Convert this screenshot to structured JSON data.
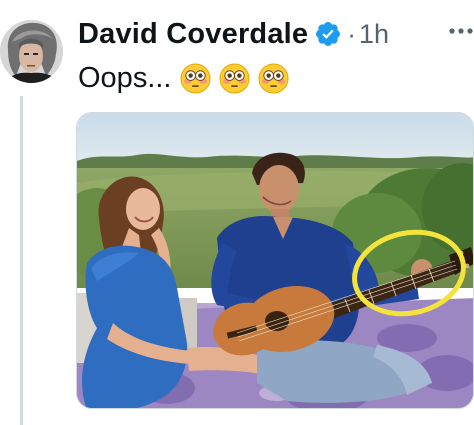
{
  "post": {
    "author_name": "David Coverdale",
    "separator": "·",
    "timestamp": "1h",
    "text": "Oops...",
    "emojis": [
      "flushed-face",
      "flushed-face",
      "flushed-face"
    ]
  },
  "icons": {
    "verified": "verified-badge-icon",
    "more": "more-options-icon"
  },
  "colors": {
    "verified_blue": "#1d9bf0",
    "text_primary": "#0f1419",
    "text_secondary": "#536471",
    "annotation_circle": "#f4e33a"
  }
}
